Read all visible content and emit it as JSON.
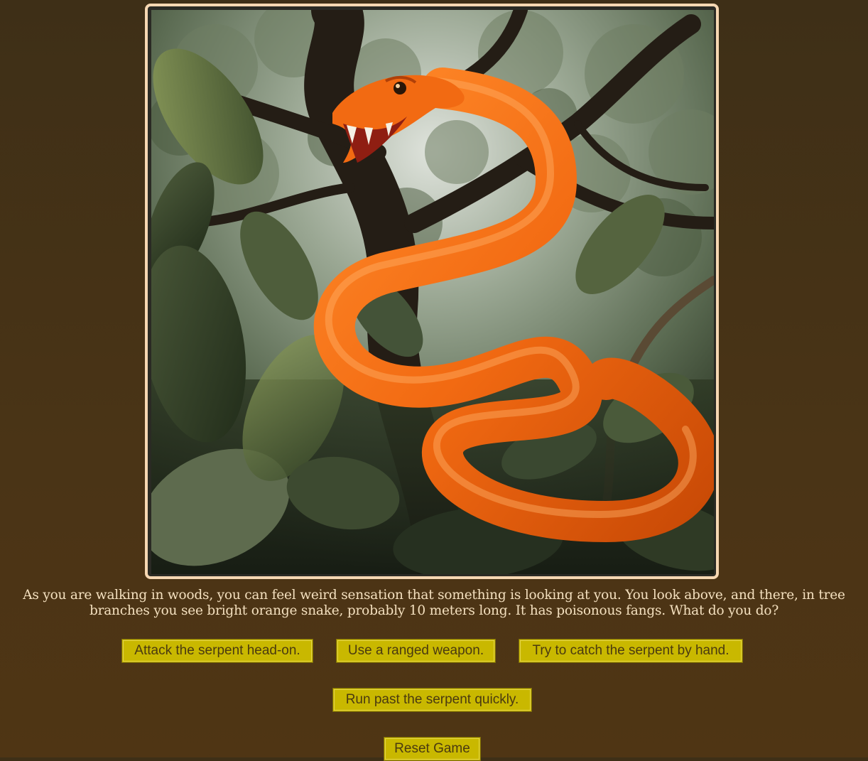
{
  "scene": {
    "image_icon": "orange-serpent-in-jungle-tree",
    "story": "As you are walking in woods, you can feel weird sensation that something is looking at you. You look above, and there, in tree branches you see bright orange snake, probably 10 meters long. It has poisonous fangs. What do you do?"
  },
  "choices": [
    "Attack the serpent head-on.",
    "Use a ranged weapon.",
    "Try to catch the serpent by hand.",
    "Run past the serpent quickly."
  ],
  "reset_label": "Reset Game",
  "colors": {
    "background": "#453214",
    "button": "#c9b800",
    "text": "#f4e0bf",
    "frame": "#f6d7b2",
    "serpent": "#f26a12"
  }
}
